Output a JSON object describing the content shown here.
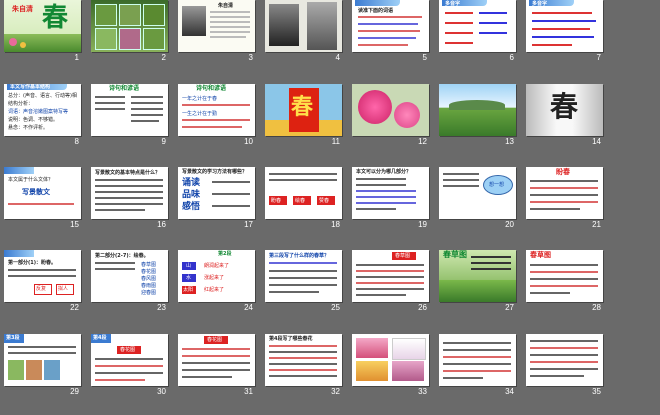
{
  "slides": [
    {
      "number": "1",
      "title": "春",
      "subtitle": "朱自清"
    },
    {
      "number": "2"
    },
    {
      "number": "3",
      "title": "朱自清"
    },
    {
      "number": "4"
    },
    {
      "number": "5",
      "title": "读准下面的词语"
    },
    {
      "number": "6",
      "title": "多音字"
    },
    {
      "number": "7",
      "title": "多音字"
    },
    {
      "number": "8",
      "title": "本文写作基本结构",
      "lines": [
        "总分：(声音、语言、行动等)相",
        "结构分析：",
        "词语：声音溶嫩图案特写等",
        "说明：色调、不够错。",
        "悬念：不作评析。"
      ]
    },
    {
      "number": "9",
      "title": "诗句和谚语"
    },
    {
      "number": "10",
      "title": "诗句和谚语",
      "lines": [
        "一年之计在于春",
        "一生之计在于勤"
      ]
    },
    {
      "number": "11",
      "title": "春"
    },
    {
      "number": "12"
    },
    {
      "number": "13"
    },
    {
      "number": "14",
      "title": "春"
    },
    {
      "number": "15",
      "lines": [
        "本文属于什么文体？",
        "写景散文"
      ]
    },
    {
      "number": "16",
      "title": "写景散文的基本特点是什么？"
    },
    {
      "number": "17",
      "title": "写景散文的学习方法有哪些？",
      "keywords": [
        "诵读",
        "品味",
        "感悟"
      ]
    },
    {
      "number": "18",
      "labels": [
        "盼春",
        "绘春",
        "赞春"
      ]
    },
    {
      "number": "19",
      "title": "本文可以分为哪几部分？"
    },
    {
      "number": "20",
      "title": "想一想"
    },
    {
      "number": "21",
      "title": "盼春"
    },
    {
      "number": "22",
      "title": "第一部分(1)：盼春。",
      "labels": [
        "反复",
        "拟人"
      ]
    },
    {
      "number": "23",
      "title": "第二部分(2-7)：绘春。",
      "labels": [
        "春草图",
        "春花图",
        "春风图",
        "春雨图",
        "迎春图"
      ]
    },
    {
      "number": "24",
      "title": "第2段",
      "labels": [
        "山",
        "水",
        "太阳",
        "朗润起来了",
        "涨起来了",
        "红起来了"
      ]
    },
    {
      "number": "25",
      "title": "第三段写了什么样的春草？"
    },
    {
      "number": "26",
      "title": "春草图"
    },
    {
      "number": "27",
      "title": "春草图"
    },
    {
      "number": "28",
      "title": "春草图"
    },
    {
      "number": "29",
      "title": "第3段"
    },
    {
      "number": "30",
      "title": "第4段",
      "labels": [
        "春花图"
      ]
    },
    {
      "number": "31",
      "title": "春花图"
    },
    {
      "number": "32",
      "title": "第4段写了哪些春花"
    },
    {
      "number": "33"
    },
    {
      "number": "34"
    },
    {
      "number": "35"
    }
  ]
}
